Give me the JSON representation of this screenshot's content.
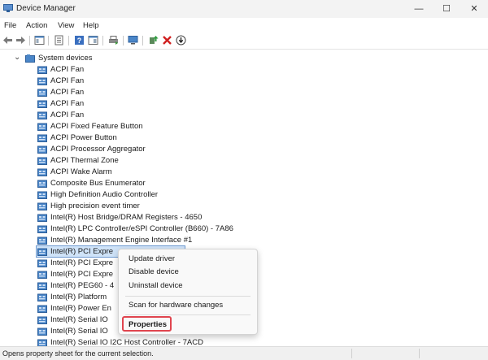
{
  "window": {
    "title": "Device Manager",
    "minimize": "—",
    "maximize": "☐",
    "close": "✕"
  },
  "menu": [
    "File",
    "Action",
    "View",
    "Help"
  ],
  "toolbar_icons": [
    "back-arrow-icon",
    "forward-arrow-icon",
    "show-hide-tree-icon",
    "properties-sheet-icon",
    "help-icon",
    "action-pane-icon",
    "print-icon",
    "scan-monitor-icon",
    "update-driver-icon",
    "uninstall-icon",
    "disable-icon"
  ],
  "tree": {
    "category": "System devices",
    "expand_glyph": "⌄",
    "devices": [
      "ACPI Fan",
      "ACPI Fan",
      "ACPI Fan",
      "ACPI Fan",
      "ACPI Fan",
      "ACPI Fixed Feature Button",
      "ACPI Power Button",
      "ACPI Processor Aggregator",
      "ACPI Thermal Zone",
      "ACPI Wake Alarm",
      "Composite Bus Enumerator",
      "High Definition Audio Controller",
      "High precision event timer",
      "Intel(R) Host Bridge/DRAM Registers - 4650",
      "Intel(R) LPC Controller/eSPI Controller (B660) - 7A86",
      "Intel(R) Management Engine Interface #1",
      "Intel(R) PCI Expre",
      "Intel(R) PCI Expre",
      "Intel(R) PCI Expre",
      "Intel(R) PEG60 - 4",
      "Intel(R) Platform",
      "Intel(R) Power En",
      "Intel(R) Serial IO",
      "Intel(R) Serial IO",
      "Intel(R) Serial IO I2C Host Controller - 7ACD"
    ],
    "selected_index": 16
  },
  "context_menu": {
    "items": [
      "Update driver",
      "Disable device",
      "Uninstall device"
    ],
    "scan": "Scan for hardware changes",
    "properties": "Properties"
  },
  "status": {
    "text": "Opens property sheet for the current selection."
  },
  "colors": {
    "highlight": "#e0454f",
    "selection": "#cfe3f8",
    "folder": "#4a86c8"
  }
}
